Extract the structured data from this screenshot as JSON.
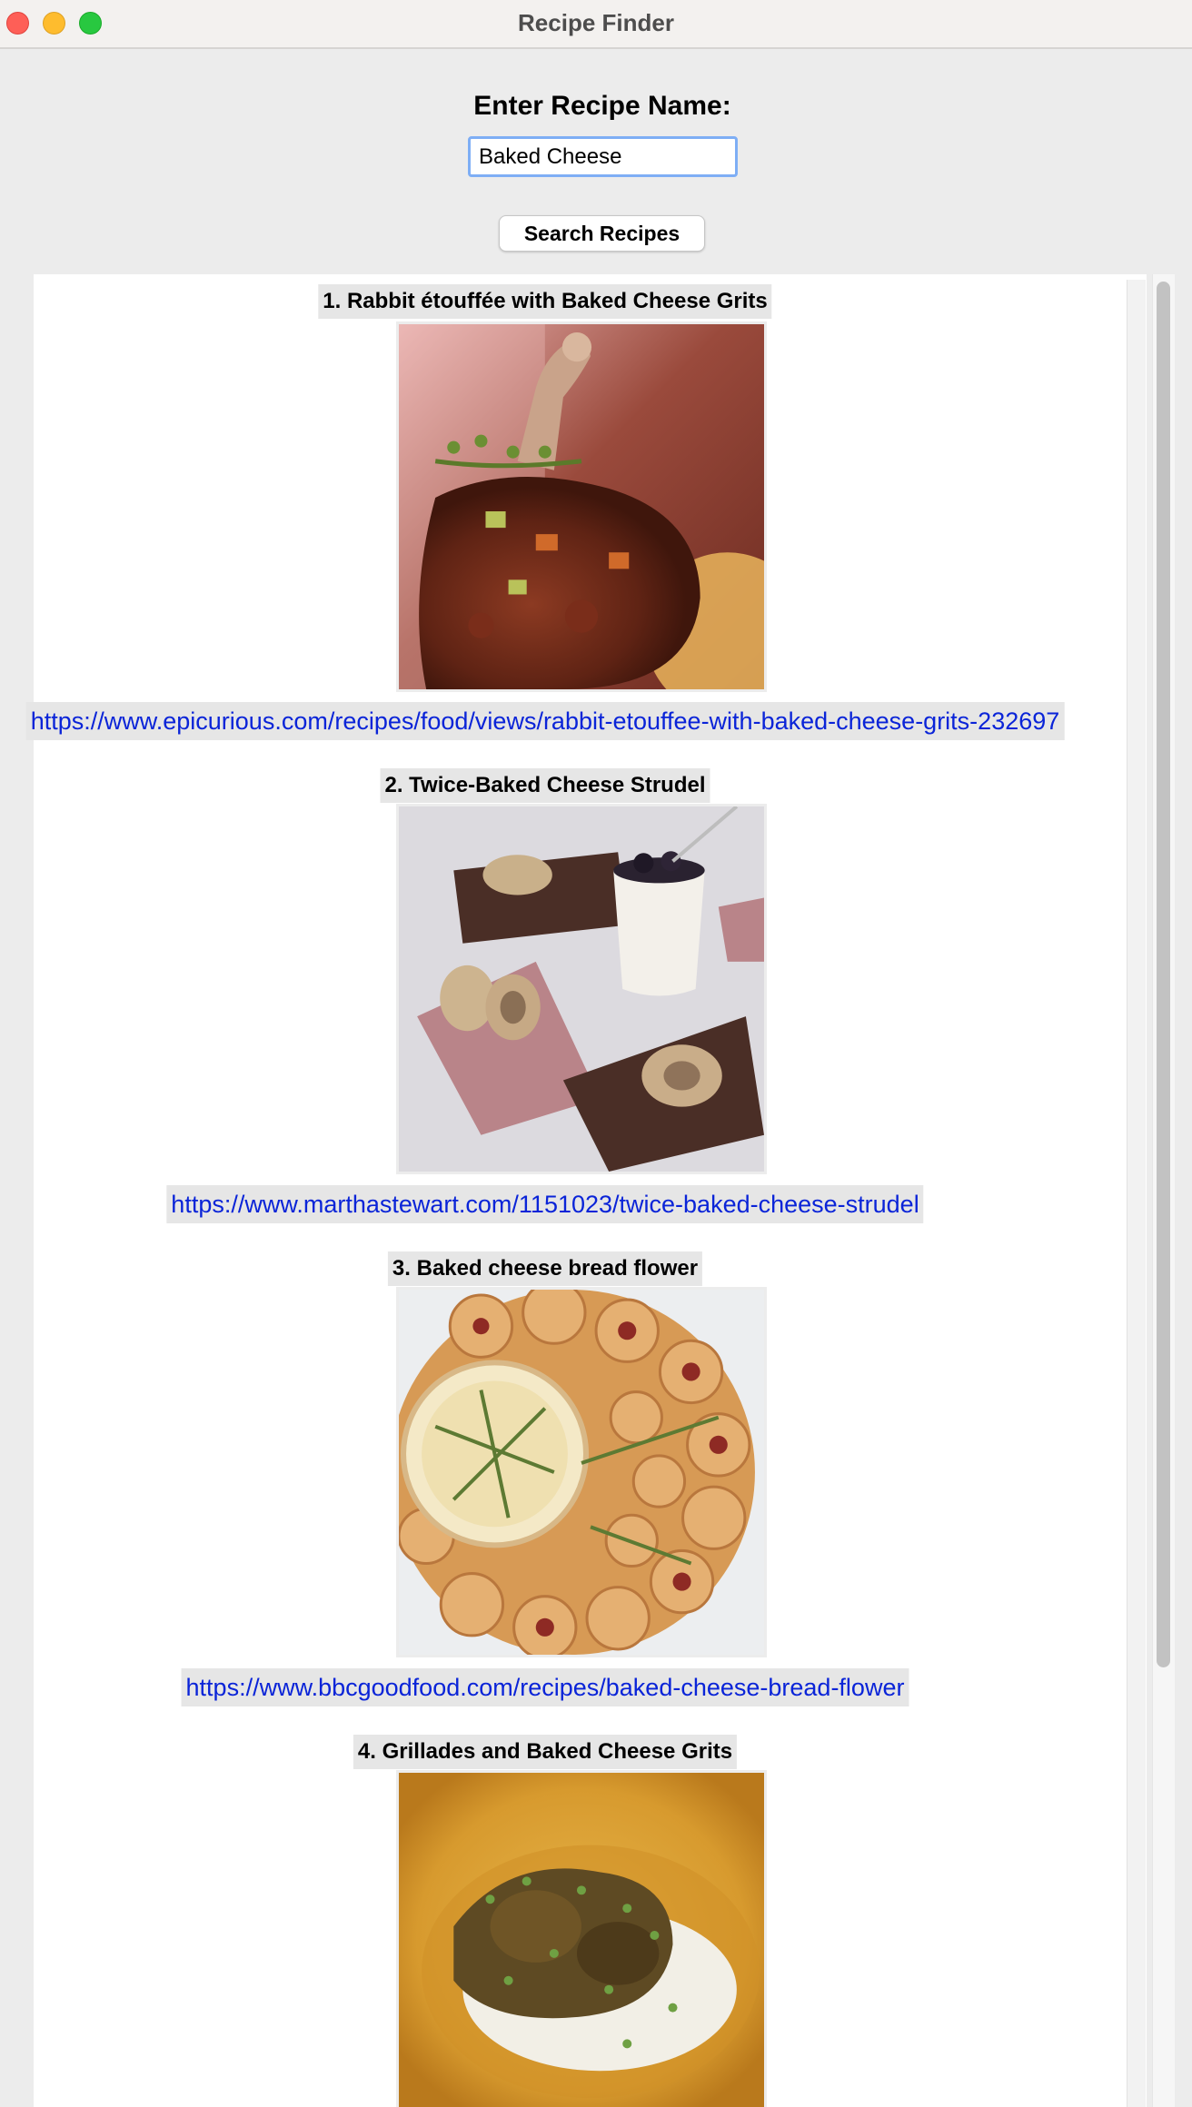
{
  "window": {
    "title": "Recipe Finder"
  },
  "form": {
    "label": "Enter Recipe Name:",
    "input_value": "Baked Cheese",
    "search_button_label": "Search Recipes"
  },
  "results": [
    {
      "title": "1. Rabbit étouffée with Baked Cheese Grits",
      "url": "https://www.epicurious.com/recipes/food/views/rabbit-etouffee-with-baked-cheese-grits-232697",
      "image_icon": "rabbit-etouffee-photo"
    },
    {
      "title": "2. Twice-Baked Cheese Strudel",
      "url": "https://www.marthastewart.com/1151023/twice-baked-cheese-strudel",
      "image_icon": "cheese-strudel-photo"
    },
    {
      "title": "3. Baked cheese bread flower",
      "url": "https://www.bbcgoodfood.com/recipes/baked-cheese-bread-flower",
      "image_icon": "cheese-bread-flower-photo"
    },
    {
      "title": "4. Grillades and Baked Cheese Grits",
      "image_icon": "grillades-grits-photo"
    }
  ],
  "colors": {
    "link": "#0a24d8",
    "input_focus": "#7eaef5",
    "close": "#fe5f57",
    "minimize": "#febc2e",
    "zoom": "#28c840"
  }
}
